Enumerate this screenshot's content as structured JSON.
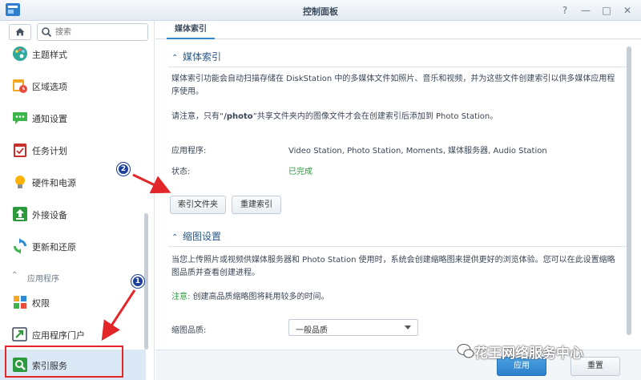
{
  "window": {
    "title": "控制面板"
  },
  "sidebar": {
    "search_placeholder": "搜索",
    "items": [
      {
        "label": "主题样式",
        "icon": "palette-icon"
      },
      {
        "label": "区域选项",
        "icon": "calendar-clock-icon"
      },
      {
        "label": "通知设置",
        "icon": "chat-bubble-icon"
      },
      {
        "label": "任务计划",
        "icon": "checklist-icon"
      },
      {
        "label": "硬件和电源",
        "icon": "lightbulb-icon"
      },
      {
        "label": "外接设备",
        "icon": "upload-icon"
      },
      {
        "label": "更新和还原",
        "icon": "refresh-icon"
      }
    ],
    "section_label": "应用程序",
    "apps": [
      {
        "label": "权限",
        "icon": "permissions-grid-icon"
      },
      {
        "label": "应用程序门户",
        "icon": "portal-arrow-icon"
      },
      {
        "label": "索引服务",
        "icon": "index-search-icon"
      }
    ]
  },
  "main": {
    "tab": "媒体索引",
    "media_index": {
      "title": "媒体索引",
      "description": "媒体索引功能会自动扫描存储在 DiskStation 中的多媒体文件如照片、音乐和视频，并为这些文件创建索引以供多媒体应用程序使用。",
      "note_prefix": "请注意，只有“",
      "note_path": "/photo",
      "note_suffix": "”共享文件夹内的图像文件才会在创建索引后添加到 Photo Station。",
      "apps_label": "应用程序:",
      "apps_value": "Video Station, Photo Station, Moments, 媒体服务器, Audio Station",
      "status_label": "状态:",
      "status_value": "已完成",
      "btn_index_folder": "索引文件夹",
      "btn_reindex": "重建索引"
    },
    "thumbnail": {
      "title": "缩图设置",
      "description": "当您上传照片或视频供媒体服务器和 Photo Station 使用时，系统会创建缩略图来提供更好的浏览体验。您可以在此设置缩略图品质并查看创建进程。",
      "note_label": "注意:",
      "note_text": "创建高品质缩略图将耗用较多的时间。",
      "quality_label": "缩图品质:",
      "quality_value": "一般品质"
    },
    "footer": {
      "apply": "应用",
      "reset": "重置"
    }
  },
  "annotations": {
    "marker1": "1",
    "marker2": "2"
  },
  "watermark": "花王网络服务中心",
  "colors": {
    "accent": "#2f8ad5",
    "status_green": "#2e9a3e",
    "annotation_red": "#e3262a",
    "marker_blue": "#1b3f9a"
  }
}
